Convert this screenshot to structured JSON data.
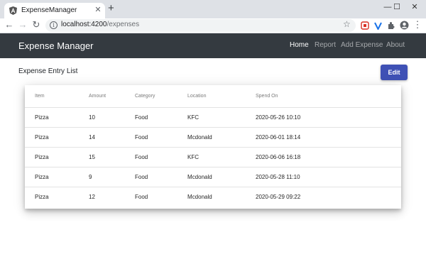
{
  "browser": {
    "tab_title": "ExpenseManager",
    "tab_close": "✕",
    "new_tab": "+",
    "url_host": "localhost:4200",
    "url_path": "/expenses",
    "window_controls": {
      "minimize": "—",
      "maximize": "☐",
      "close": "✕"
    }
  },
  "navbar": {
    "brand": "Expense Manager",
    "links": [
      {
        "label": "Home",
        "active": true
      },
      {
        "label": "Report",
        "active": false
      },
      {
        "label": "Add Expense",
        "active": false
      },
      {
        "label": "About",
        "active": false
      }
    ]
  },
  "page": {
    "heading": "Expense Entry List",
    "edit_label": "Edit",
    "accent_color": "#3f51b5"
  },
  "table": {
    "columns": [
      "Item",
      "Amount",
      "Category",
      "Location",
      "Spend On"
    ],
    "rows": [
      [
        "Pizza",
        "10",
        "Food",
        "KFC",
        "2020-05-26 10:10"
      ],
      [
        "Pizza",
        "14",
        "Food",
        "Mcdonald",
        "2020-06-01 18:14"
      ],
      [
        "Pizza",
        "15",
        "Food",
        "KFC",
        "2020-06-06 16:18"
      ],
      [
        "Pizza",
        "9",
        "Food",
        "Mcdonald",
        "2020-05-28 11:10"
      ],
      [
        "Pizza",
        "12",
        "Food",
        "Mcdonald",
        "2020-05-29 09:22"
      ]
    ]
  }
}
